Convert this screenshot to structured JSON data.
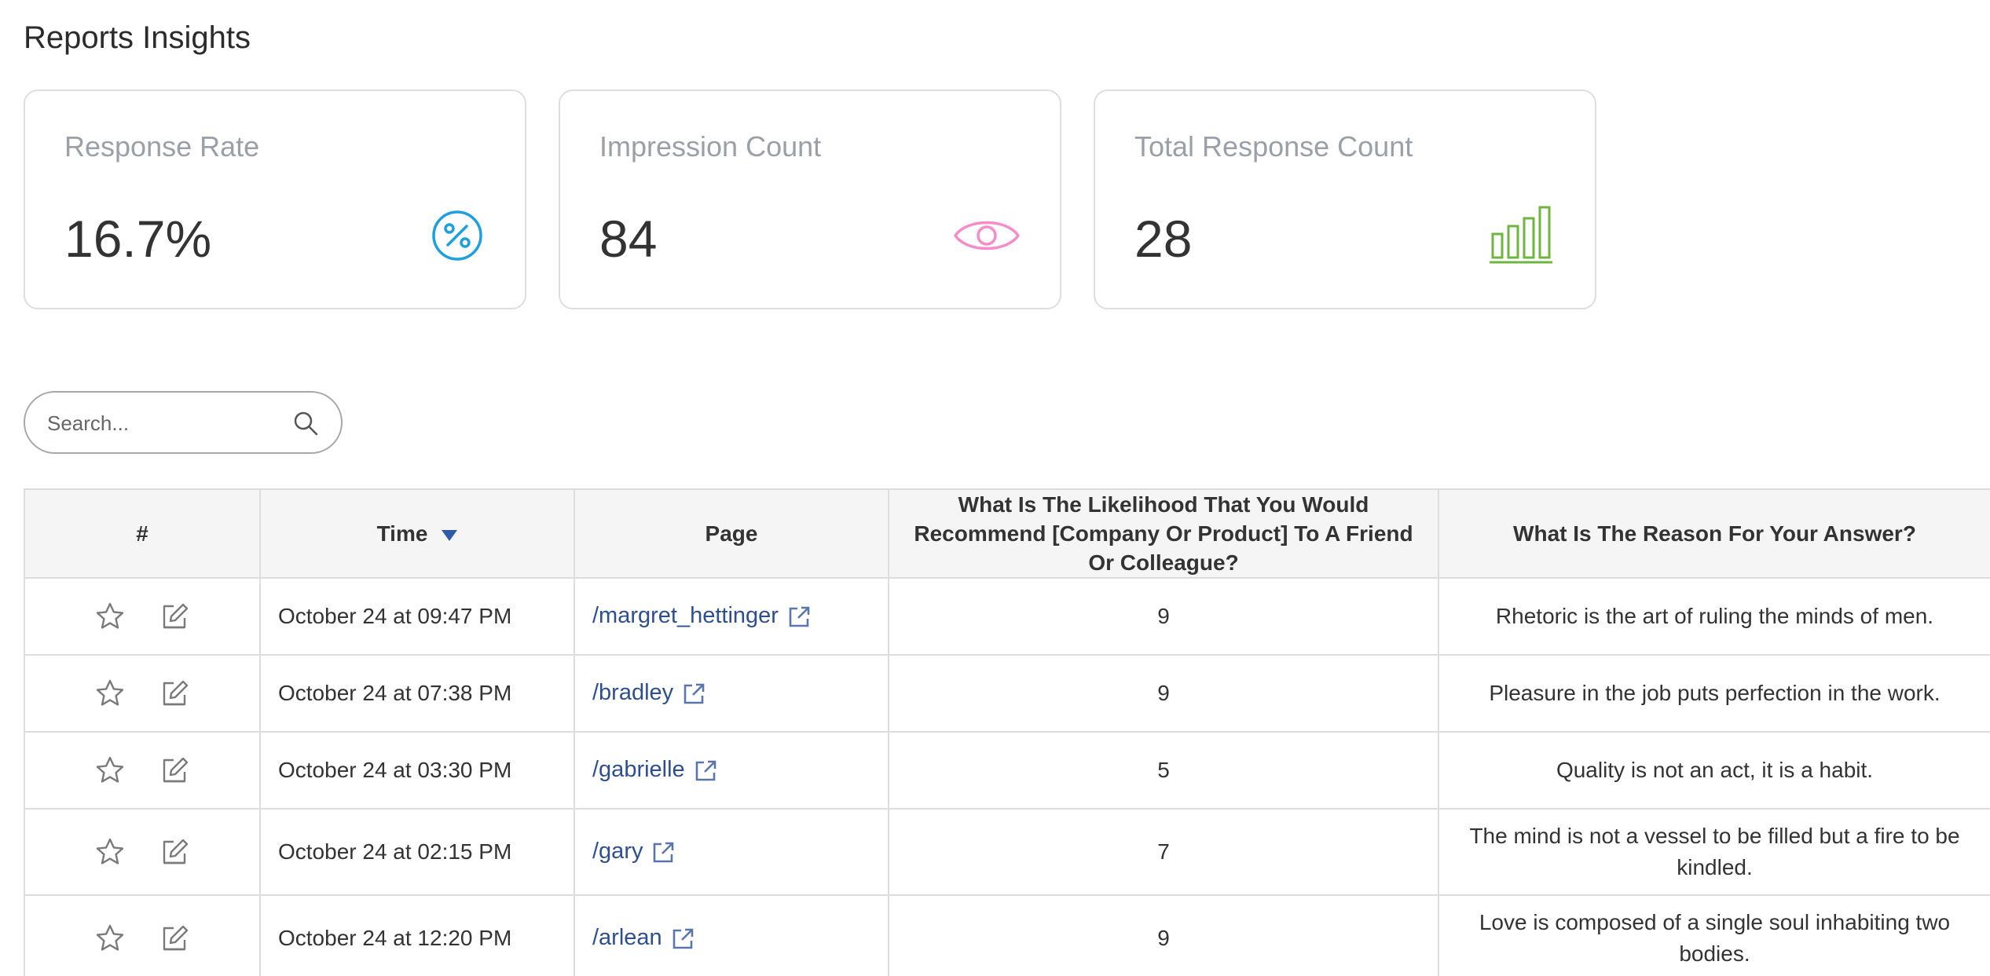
{
  "page": {
    "title": "Reports Insights"
  },
  "cards": [
    {
      "label": "Response Rate",
      "value": "16.7%",
      "icon": "percent-icon",
      "color": "#1fa0de"
    },
    {
      "label": "Impression Count",
      "value": "84",
      "icon": "eye-icon",
      "color": "#f48dc9"
    },
    {
      "label": "Total Response Count",
      "value": "28",
      "icon": "bar-chart-icon",
      "color": "#6db53f"
    }
  ],
  "search": {
    "placeholder": "Search..."
  },
  "table": {
    "headers": {
      "num": "#",
      "time": "Time",
      "page": "Page",
      "score": "What Is The Likelihood That You Would Recommend [Company Or Product] To A Friend Or Colleague?",
      "reason": "What Is The Reason For Your Answer?"
    },
    "sort": {
      "column": "time",
      "direction": "descending"
    },
    "link_color": "#2e4f8f",
    "rows": [
      {
        "time": "October 24 at 09:47 PM",
        "page": "/margret_hettinger",
        "score": "9",
        "reason": "Rhetoric is the art of ruling the minds of men."
      },
      {
        "time": "October 24 at 07:38 PM",
        "page": "/bradley",
        "score": "9",
        "reason": "Pleasure in the job puts perfection in the work."
      },
      {
        "time": "October 24 at 03:30 PM",
        "page": "/gabrielle",
        "score": "5",
        "reason": "Quality is not an act, it is a habit."
      },
      {
        "time": "October 24 at 02:15 PM",
        "page": "/gary",
        "score": "7",
        "reason": "The mind is not a vessel to be filled but a fire to be kindled."
      },
      {
        "time": "October 24 at 12:20 PM",
        "page": "/arlean",
        "score": "9",
        "reason": "Love is composed of a single soul inhabiting two bodies."
      }
    ]
  }
}
